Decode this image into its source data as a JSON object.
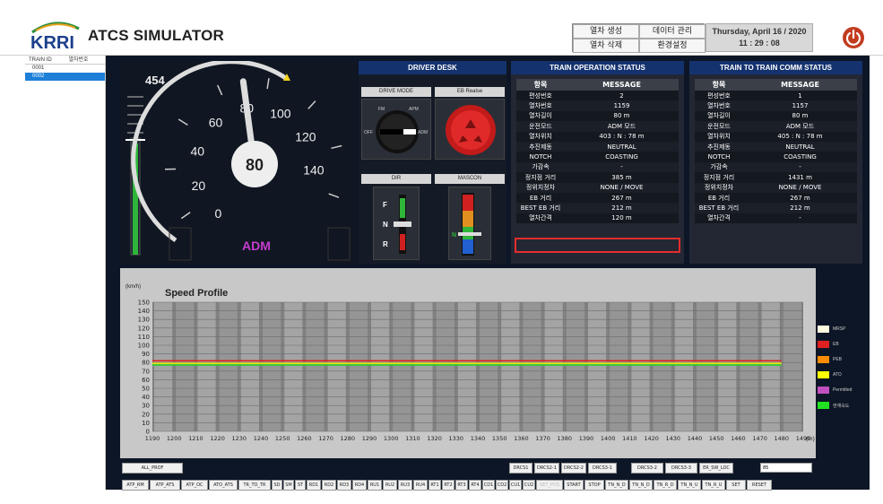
{
  "header": {
    "app_title": "ATCS SIMULATOR",
    "logo_text": "KRRI",
    "menu": [
      "열차 생성",
      "데이터 관리",
      "열차 삭제",
      "환경설정"
    ],
    "date": "Thursday, April 16 / 2020",
    "time": "11 : 29 : 08",
    "accent_power": "#c23b1e"
  },
  "train_list": {
    "headers": [
      "TRAIN ID",
      "열차번호"
    ],
    "rows": [
      "0001",
      "0002"
    ],
    "selected": "0002"
  },
  "gauge": {
    "speed_limit_readout": "454",
    "current_speed": "80",
    "mode_label": "ADM",
    "ticks": [
      "0",
      "20",
      "40",
      "60",
      "80",
      "100",
      "120",
      "140"
    ],
    "needle_value": 80,
    "max_value": 150
  },
  "driver_desk": {
    "title": "DRIVER DESK",
    "drive_mode_label": "DRIVE MODE",
    "eb_label": "EB Realse",
    "dir_label": "DIR",
    "mascon_label": "MASCON",
    "knob_labels": [
      "FM",
      "APM",
      "OFF",
      "ADM"
    ],
    "dir_letters": [
      "F",
      "N",
      "R"
    ],
    "mascon_letter": "N"
  },
  "train_op_status": {
    "title": "TRAIN OPERATION STATUS",
    "col_headers": [
      "항목",
      "MESSAGE"
    ],
    "rows": [
      [
        "편성번호",
        "2"
      ],
      [
        "열차번호",
        "1159"
      ],
      [
        "열차길이",
        "80 m"
      ],
      [
        "운전모드",
        "ADM 모드"
      ],
      [
        "열차위치",
        "403 : N : 78 m"
      ],
      [
        "추진제동",
        "NEUTRAL"
      ],
      [
        "NOTCH",
        "COASTING"
      ],
      [
        "가감속",
        "-"
      ],
      [
        "정지점 거리",
        "385 m"
      ],
      [
        "정위치정차",
        "NONE / MOVE"
      ],
      [
        "EB 거리",
        "267 m"
      ],
      [
        "BEST EB 거리",
        "212 m"
      ],
      [
        "열차간격",
        "120 m"
      ]
    ]
  },
  "t2t_status": {
    "title": "TRAIN TO TRAIN COMM STATUS",
    "col_headers": [
      "항목",
      "MESSAGE"
    ],
    "rows": [
      [
        "편성번호",
        "1"
      ],
      [
        "열차번호",
        "1157"
      ],
      [
        "열차길이",
        "80 m"
      ],
      [
        "운전모드",
        "ADM 모드"
      ],
      [
        "열차위치",
        "405 : N : 78 m"
      ],
      [
        "추진제동",
        "NEUTRAL"
      ],
      [
        "NOTCH",
        "COASTING"
      ],
      [
        "가감속",
        "-"
      ],
      [
        "정지점 거리",
        "1431 m"
      ],
      [
        "정위치정차",
        "NONE / MOVE"
      ],
      [
        "EB 거리",
        "267 m"
      ],
      [
        "BEST EB 거리",
        "212 m"
      ],
      [
        "열차간격",
        "-"
      ]
    ]
  },
  "speed_profile": {
    "title": "Speed Profile",
    "y_unit": "(km/h)",
    "x_unit": "(m)",
    "y_ticks": [
      "0",
      "10",
      "20",
      "30",
      "40",
      "50",
      "60",
      "70",
      "80",
      "90",
      "100",
      "110",
      "120",
      "130",
      "140",
      "150"
    ],
    "x_ticks": [
      "1190",
      "1200",
      "1210",
      "1220",
      "1230",
      "1240",
      "1250",
      "1260",
      "1270",
      "1280",
      "1290",
      "1300",
      "1310",
      "1320",
      "1330",
      "1340",
      "1350",
      "1360",
      "1370",
      "1380",
      "1390",
      "1400",
      "1410",
      "1420",
      "1430",
      "1440",
      "1450",
      "1460",
      "1470",
      "1480",
      "1490"
    ],
    "lines": [
      {
        "name": "MRSP",
        "value": 82,
        "color": "#ffffff"
      },
      {
        "name": "EB",
        "value": 82,
        "color": "#e02020"
      },
      {
        "name": "ATO",
        "value": 79,
        "color": "#e8e810"
      },
      {
        "name": "현재속도",
        "value": 77,
        "color": "#28d128"
      }
    ],
    "x_range": [
      1190,
      1490
    ],
    "y_range": [
      0,
      150
    ]
  },
  "legend": [
    {
      "label": "MRSP",
      "color": "#ffffe0"
    },
    {
      "label": "EB",
      "color": "#e02020"
    },
    {
      "label": "PEB",
      "color": "#ff8c00"
    },
    {
      "label": "ATO",
      "color": "#ffff00"
    },
    {
      "label": "Permitted",
      "color": "#c050c0"
    },
    {
      "label": "현재속도",
      "color": "#20e020"
    }
  ],
  "buttons": {
    "row1": [
      "ALL_PROF",
      "DRCS1",
      "DRCS2-1",
      "DRCS2-2",
      "DRCS3-1",
      "DRCS3-2",
      "DRCS3-3",
      "ER_SW_LOC"
    ],
    "set_value": "85",
    "row2": [
      "ATP_RM",
      "ATP_ATS",
      "ATP_OC",
      "ATO_ATS",
      "TR_TO_TR",
      "SD",
      "SM",
      "ST",
      "RD1",
      "RD2",
      "RD3",
      "RD4",
      "RU1",
      "RU2",
      "RU3",
      "RU4",
      "RT1",
      "RT2",
      "RT3",
      "RT4",
      "CD1",
      "CD2",
      "CU1",
      "CU2",
      "SET_POS",
      "START",
      "STOP",
      "TN_N_D",
      "TN_N_D",
      "TN_R_D",
      "TN_N_U",
      "TN_R_U",
      "SET",
      "RESET"
    ]
  }
}
